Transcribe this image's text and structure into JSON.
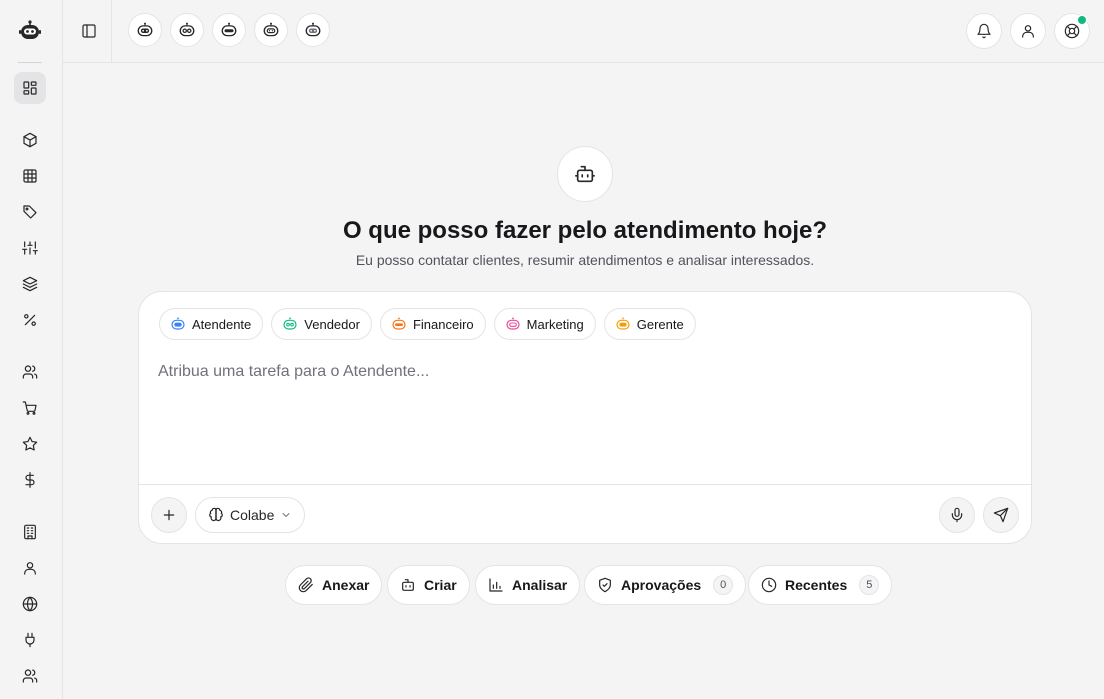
{
  "header": {
    "agent_chips": [
      "bot-atendente-icon",
      "bot-vendedor-icon",
      "bot-financeiro-icon",
      "bot-marketing-icon",
      "bot-gerente-icon"
    ],
    "actions": [
      "bell-icon",
      "user-icon",
      "help-lifebuoy-icon"
    ],
    "online_color": "#10b981"
  },
  "sidebar": {
    "items": [
      {
        "icon": "dashboard-icon",
        "active": true
      },
      {
        "icon": "package-icon"
      },
      {
        "icon": "grid-table-icon"
      },
      {
        "icon": "tag-icon"
      },
      {
        "icon": "sliders-icon"
      },
      {
        "icon": "layers-icon"
      },
      {
        "icon": "percent-icon"
      },
      {
        "icon": "users-icon"
      },
      {
        "icon": "cart-icon"
      },
      {
        "icon": "star-icon"
      },
      {
        "icon": "dollar-icon"
      },
      {
        "icon": "building-icon"
      },
      {
        "icon": "user-icon"
      },
      {
        "icon": "globe-icon"
      },
      {
        "icon": "plug-icon"
      },
      {
        "icon": "team-icon"
      }
    ]
  },
  "hero": {
    "title": "O que posso fazer pelo atendimento hoje?",
    "subtitle": "Eu posso contatar clientes, resumir atendimentos e analisar interessados."
  },
  "composer": {
    "agents": [
      {
        "label": "Atendente",
        "color": "#3b82f6"
      },
      {
        "label": "Vendedor",
        "color": "#10b981"
      },
      {
        "label": "Financeiro",
        "color": "#f97316"
      },
      {
        "label": "Marketing",
        "color": "#ec4899"
      },
      {
        "label": "Gerente",
        "color": "#f59e0b"
      }
    ],
    "placeholder": "Atribua uma tarefa para o Atendente...",
    "model": "Colabe"
  },
  "quick_actions": {
    "attach": "Anexar",
    "create": "Criar",
    "analyze": "Analisar",
    "approvals": "Aprovações",
    "approvals_count": "0",
    "recent": "Recentes",
    "recent_count": "5"
  }
}
